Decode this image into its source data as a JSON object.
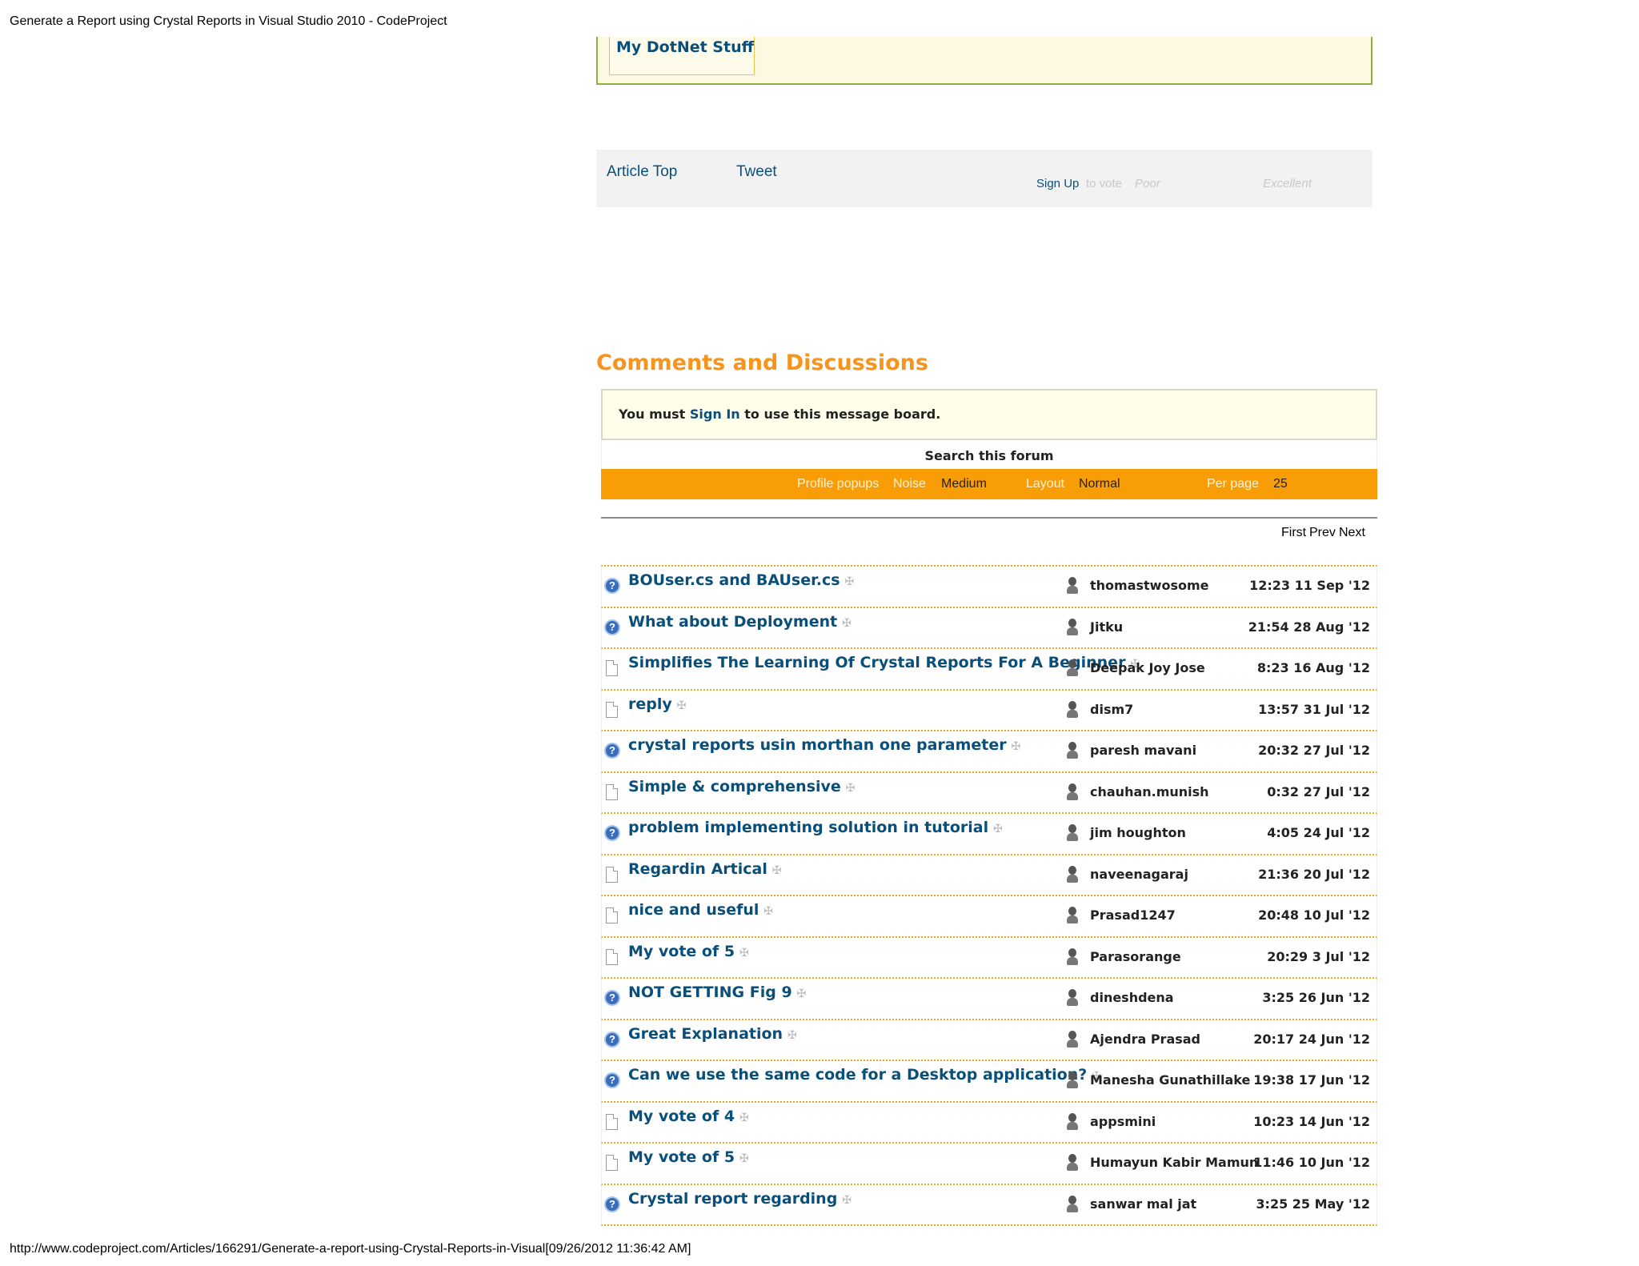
{
  "page": {
    "title": "Generate a Report using Crystal Reports in Visual Studio 2010 - CodeProject",
    "footer": "http://www.codeproject.com/Articles/166291/Generate-a-report-using-Crystal-Reports-in-Visual[09/26/2012 11:36:42 AM]"
  },
  "author_box": {
    "link": "My DotNet Stuff"
  },
  "vote_bar": {
    "article_top": "Article Top",
    "tweet": "Tweet",
    "sign_up": "Sign Up",
    "to_vote": "to vote",
    "poor": "Poor",
    "excellent": "Excellent"
  },
  "discussions": {
    "heading": "Comments and Discussions",
    "signin_prefix": "You must",
    "signin_link": "Sign In",
    "signin_suffix": "to use this message board.",
    "search": "Search this forum",
    "options": {
      "profile_popups": "Profile popups",
      "noise_label": "Noise",
      "noise_value": "Medium",
      "layout_label": "Layout",
      "layout_value": "Normal",
      "per_page_label": "Per page",
      "per_page_value": "25"
    },
    "pager": {
      "first": "First",
      "prev": "Prev",
      "next": "Next"
    },
    "messages": [
      {
        "type": "question",
        "subject": "BOUser.cs and BAUser.cs",
        "author": "thomastwosome",
        "date": "12:23 11 Sep '12"
      },
      {
        "type": "question",
        "subject": "What about Deployment",
        "author": "Jitku",
        "date": "21:54 28 Aug '12"
      },
      {
        "type": "comment",
        "subject": "Simplifies The Learning Of Crystal Reports For A Beginner",
        "author": "Deepak Joy Jose",
        "date": "8:23 16 Aug '12"
      },
      {
        "type": "comment",
        "subject": "reply",
        "author": "dism7",
        "date": "13:57 31 Jul '12"
      },
      {
        "type": "question",
        "subject": "crystal reports usin morthan one parameter",
        "author": "paresh mavani",
        "date": "20:32 27 Jul '12"
      },
      {
        "type": "comment",
        "subject": "Simple & comprehensive",
        "author": "chauhan.munish",
        "date": "0:32 27 Jul '12"
      },
      {
        "type": "question",
        "subject": "problem implementing solution in tutorial",
        "author": "jim houghton",
        "date": "4:05 24 Jul '12"
      },
      {
        "type": "comment",
        "subject": "Regardin Artical",
        "author": "naveenagaraj",
        "date": "21:36 20 Jul '12"
      },
      {
        "type": "comment",
        "subject": "nice and useful",
        "author": "Prasad1247",
        "date": "20:48 10 Jul '12"
      },
      {
        "type": "comment",
        "subject": "My vote of 5",
        "author": "Parasorange",
        "date": "20:29 3 Jul '12"
      },
      {
        "type": "question",
        "subject": "NOT GETTING Fig 9",
        "author": "dineshdena",
        "date": "3:25 26 Jun '12"
      },
      {
        "type": "question",
        "subject": "Great Explanation",
        "author": "Ajendra Prasad",
        "date": "20:17 24 Jun '12"
      },
      {
        "type": "question",
        "subject": "Can we use the same code for a Desktop application?",
        "author": "Manesha Gunathillake",
        "date": "19:38 17 Jun '12"
      },
      {
        "type": "comment",
        "subject": "My vote of 4",
        "author": "appsmini",
        "date": "10:23 14 Jun '12"
      },
      {
        "type": "comment",
        "subject": "My vote of 5",
        "author": "Humayun Kabir Mamun",
        "date": "11:46 10 Jun '12"
      },
      {
        "type": "question",
        "subject": "Crystal report regarding",
        "author": "sanwar mal jat",
        "date": "3:25 25 May '12"
      }
    ]
  }
}
